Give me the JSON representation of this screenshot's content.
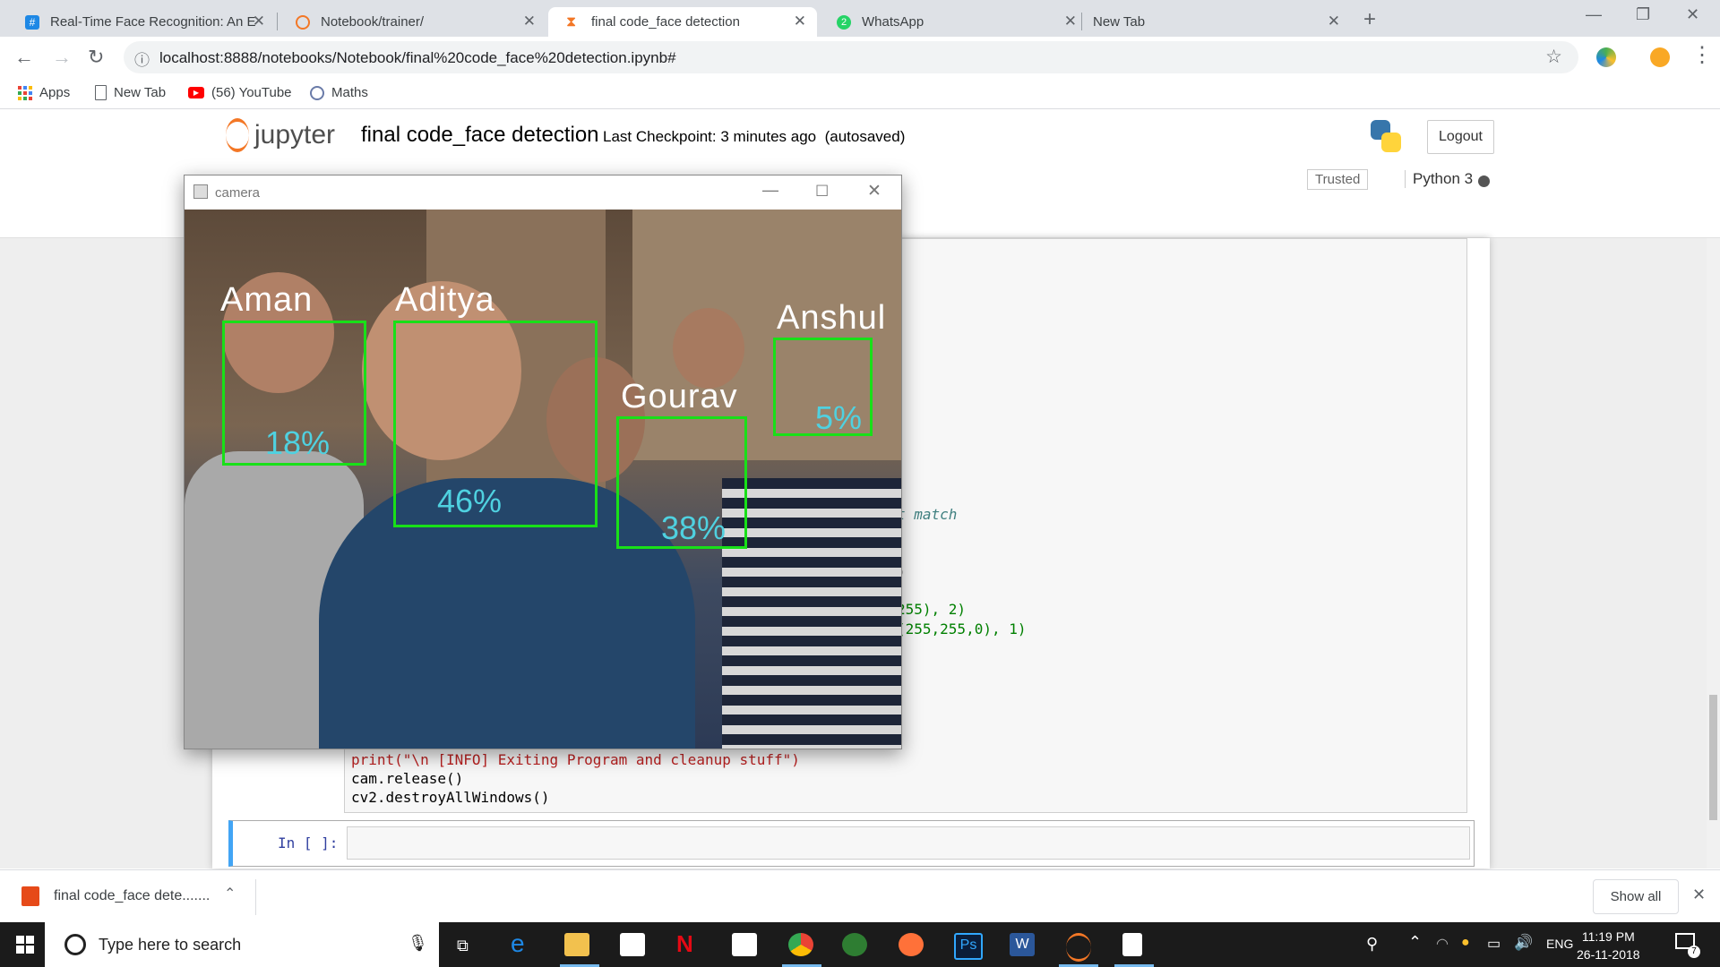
{
  "browser": {
    "tabs": [
      {
        "title": "Real-Time Face Recognition: An E",
        "icon": "hashtag-icon"
      },
      {
        "title": "Notebook/trainer/",
        "icon": "jupyter-icon"
      },
      {
        "title": "final code_face detection",
        "icon": "hourglass-icon",
        "active": true
      },
      {
        "title": "WhatsApp",
        "icon": "whatsapp-icon"
      },
      {
        "title": "New Tab",
        "icon": ""
      }
    ],
    "url": "localhost:8888/notebooks/Notebook/final%20code_face%20detection.ipynb#",
    "bookmarks": [
      "Apps",
      "New Tab",
      "(56) YouTube",
      "Maths"
    ]
  },
  "jupyter": {
    "logo_text": "jupyter",
    "notebook_name": "final code_face detection",
    "checkpoint": "Last Checkpoint: 3 minutes ago",
    "autosaved": "(autosaved)",
    "logout": "Logout",
    "trusted": "Trusted",
    "kernel": "Python 3"
  },
  "code": {
    "fragment_comment": "t match",
    "fragment_paren": ")",
    "fragment_rect": "255), 2)",
    "fragment_text": "(255,255,0), 1)",
    "line_print": "print(\"\\n [INFO] Exiting Program and cleanup stuff\")",
    "line_release": "cam.release()",
    "line_destroy": "cv2.destroyAllWindows()",
    "empty_prompt": "In [ ]:"
  },
  "camera": {
    "title": "camera",
    "faces": [
      {
        "name": "Aman",
        "confidence": "18%"
      },
      {
        "name": "Aditya",
        "confidence": "46%"
      },
      {
        "name": "Gourav",
        "confidence": "38%"
      },
      {
        "name": "Anshul",
        "confidence": "5%"
      }
    ]
  },
  "downloads": {
    "file": "final code_face dete.......",
    "show_all": "Show all"
  },
  "taskbar": {
    "search_placeholder": "Type here to search",
    "language": "ENG",
    "time": "11:19 PM",
    "date": "26-11-2018",
    "notification_count": "7"
  }
}
